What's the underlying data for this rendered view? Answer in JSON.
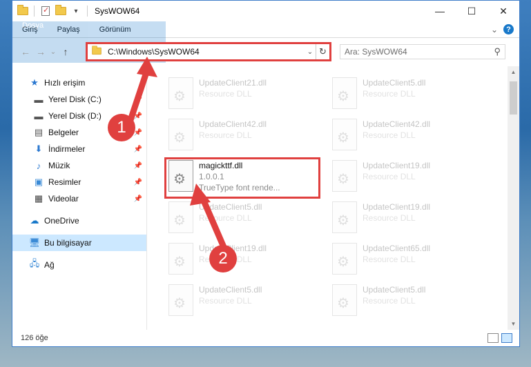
{
  "window": {
    "title": "SysWOW64",
    "controls": {
      "minimize": "—",
      "maximize": "☐",
      "close": "✕"
    }
  },
  "ribbon": {
    "tabs": [
      "Dosya",
      "Giriş",
      "Paylaş",
      "Görünüm"
    ],
    "expand_glyph": "⌄",
    "help_glyph": "?"
  },
  "address": {
    "back": "←",
    "forward": "→",
    "recent": "⌄",
    "up": "↑",
    "path": "C:\\Windows\\SysWOW64",
    "dropdown": "⌄",
    "refresh": "↻"
  },
  "search": {
    "placeholder": "Ara: SysWOW64",
    "icon_glyph": "⚲"
  },
  "nav": {
    "quick_access": "Hızlı erişim",
    "items": [
      {
        "label": "Yerel Disk (C:)",
        "icon": "drive-icon"
      },
      {
        "label": "Yerel Disk (D:)",
        "icon": "drive-icon"
      },
      {
        "label": "Belgeler",
        "icon": "documents-icon"
      },
      {
        "label": "İndirmeler",
        "icon": "downloads-icon"
      },
      {
        "label": "Müzik",
        "icon": "music-icon"
      },
      {
        "label": "Resimler",
        "icon": "pictures-icon"
      },
      {
        "label": "Videolar",
        "icon": "videos-icon"
      }
    ],
    "onedrive": "OneDrive",
    "this_pc": "Bu bilgisayar",
    "network": "Ağ"
  },
  "files": {
    "left": [
      {
        "name": "UpdateClient21.dll",
        "sub": "Resource DLL"
      },
      {
        "name": "UpdateClient42.dll",
        "sub": "Resource DLL"
      },
      {
        "name": "magickttf.dll",
        "sub": "1.0.0.1",
        "sub2": "TrueType font rende..."
      },
      {
        "name": "UpdateClient5.dll",
        "sub": "Resource DLL"
      },
      {
        "name": "UpdateClient19.dll",
        "sub": "Resource DLL"
      },
      {
        "name": "UpdateClient5.dll",
        "sub": "Resource DLL"
      }
    ],
    "right": [
      {
        "name": "UpdateClient5.dll",
        "sub": "Resource DLL"
      },
      {
        "name": "UpdateClient42.dll",
        "sub": "Resource DLL"
      },
      {
        "name": "UpdateClient19.dll",
        "sub": "Resource DLL"
      },
      {
        "name": "UpdateClient19.dll",
        "sub": "Resource DLL"
      },
      {
        "name": "UpdateClient65.dll",
        "sub": "Resource DLL"
      },
      {
        "name": "UpdateClient5.dll",
        "sub": "Resource DLL"
      }
    ]
  },
  "status": {
    "count": "126 öğe"
  },
  "annotations": {
    "step1": "1",
    "step2": "2"
  },
  "colors": {
    "accent": "#1979ca",
    "highlight": "#e0403f"
  }
}
